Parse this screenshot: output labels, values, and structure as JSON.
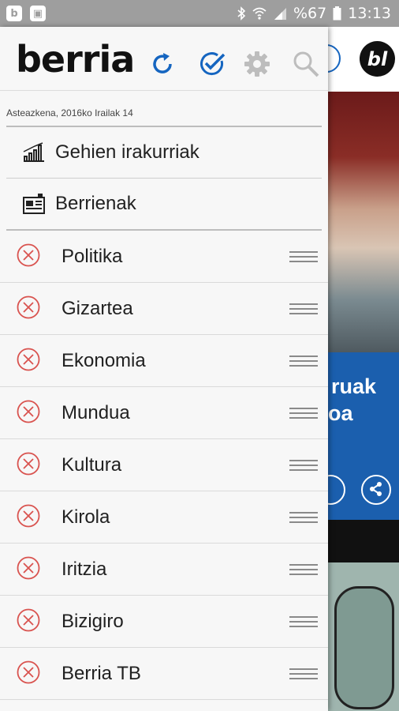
{
  "status_bar": {
    "left_icons": [
      "b-app-icon",
      "gallery-icon"
    ],
    "battery": "%67",
    "time": "13:13"
  },
  "background_app": {
    "logo": "bl",
    "headline_fragment_1": "ruak",
    "headline_fragment_2": "oa"
  },
  "drawer": {
    "logo": "berria",
    "header_icons": [
      "refresh-icon",
      "check-icon",
      "settings-icon",
      "search-icon"
    ],
    "date": "Asteazkena, 2016ko Irailak 14",
    "special_items": [
      {
        "label": "Gehien irakurriak",
        "icon": "bar-chart-icon"
      },
      {
        "label": "Berrienak",
        "icon": "newspaper-icon"
      }
    ],
    "sections": [
      {
        "label": "Politika"
      },
      {
        "label": "Gizartea"
      },
      {
        "label": "Ekonomia"
      },
      {
        "label": "Mundua"
      },
      {
        "label": "Kultura"
      },
      {
        "label": "Kirola"
      },
      {
        "label": "Iritzia"
      },
      {
        "label": "Bizigiro"
      },
      {
        "label": "Berria TB"
      }
    ]
  },
  "colors": {
    "status_bar": "#9e9e9e",
    "accent_blue": "#1565c0",
    "remove_red": "#d9534f",
    "drawer_bg": "#f7f7f7"
  }
}
